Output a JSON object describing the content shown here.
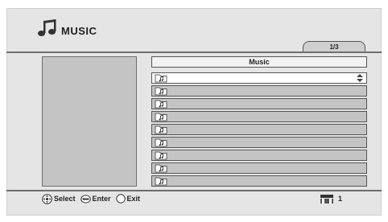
{
  "header": {
    "title": "MUSIC",
    "icon": "music-note-icon"
  },
  "page_indicator": "1/3",
  "list": {
    "header": "Music",
    "rows": [
      {
        "icon": "music-file-icon",
        "label": "",
        "selected": true
      },
      {
        "icon": "music-file-icon",
        "label": "",
        "selected": false
      },
      {
        "icon": "music-file-icon",
        "label": "",
        "selected": false
      },
      {
        "icon": "music-file-icon",
        "label": "",
        "selected": false
      },
      {
        "icon": "music-file-icon",
        "label": "",
        "selected": false
      },
      {
        "icon": "music-file-icon",
        "label": "",
        "selected": false
      },
      {
        "icon": "music-file-icon",
        "label": "",
        "selected": false
      },
      {
        "icon": "music-file-icon",
        "label": "",
        "selected": false
      },
      {
        "icon": "music-file-icon",
        "label": "",
        "selected": false
      }
    ]
  },
  "footer": {
    "select_label": "Select",
    "enter_label": "Enter",
    "exit_label": "Exit"
  },
  "disc": {
    "icon": "disc-tray-icon",
    "value": "1"
  }
}
